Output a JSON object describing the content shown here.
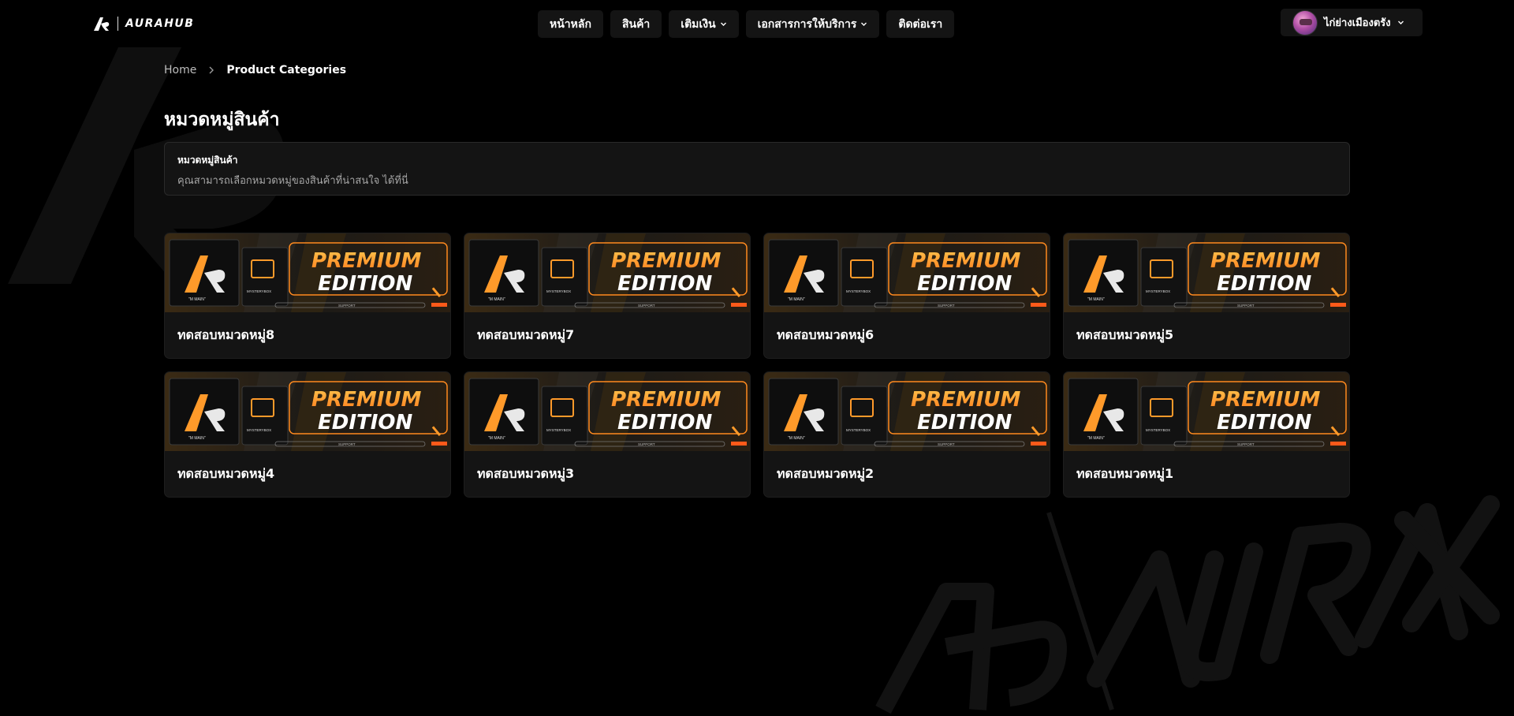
{
  "brand": {
    "name": "AURAHUB"
  },
  "nav": [
    {
      "label": "หน้าหลัก",
      "has_dropdown": false
    },
    {
      "label": "สินค้า",
      "has_dropdown": false
    },
    {
      "label": "เติมเงิน",
      "has_dropdown": true
    },
    {
      "label": "เอกสารการให้บริการ",
      "has_dropdown": true
    },
    {
      "label": "ติดต่อเรา",
      "has_dropdown": false
    }
  ],
  "profile": {
    "name": "ไก่ย่างเมืองตรัง"
  },
  "breadcrumb": {
    "home": "Home",
    "current": "Product Categories"
  },
  "page": {
    "title": "หมวดหมู่สินค้า"
  },
  "info": {
    "title": "หมวดหมู่สินค้า",
    "description": "คุณสามารถเลือกหมวดหมู่ของสินค้าที่น่าสนใจ ได้ที่นี่"
  },
  "banner": {
    "line1": "PREMIUM",
    "line2": "EDITION",
    "support_text": "SUPPORT"
  },
  "categories": [
    {
      "title": "ทดสอบหมวดหมู่8"
    },
    {
      "title": "ทดสอบหมวดหมู่7"
    },
    {
      "title": "ทดสอบหมวดหมู่6"
    },
    {
      "title": "ทดสอบหมวดหมู่5"
    },
    {
      "title": "ทดสอบหมวดหมู่4"
    },
    {
      "title": "ทดสอบหมวดหมู่3"
    },
    {
      "title": "ทดสอบหมวดหมู่2"
    },
    {
      "title": "ทดสอบหมวดหมู่1"
    }
  ],
  "colors": {
    "background": "#000000",
    "surface": "#141414",
    "banner_accent": "#ff8a1e",
    "banner_gold": "#f4b028"
  }
}
